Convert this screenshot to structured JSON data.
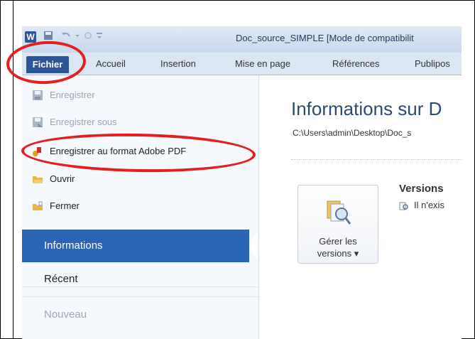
{
  "window": {
    "logo_letter": "W",
    "title": "Doc_source_SIMPLE [Mode de compatibilit"
  },
  "ribbon": {
    "tabs": [
      "Fichier",
      "Accueil",
      "Insertion",
      "Mise en page",
      "Références",
      "Publipos"
    ]
  },
  "backstage": {
    "menu": [
      {
        "label": "Enregistrer",
        "icon": "save-icon",
        "disabled": true
      },
      {
        "label": "Enregistrer sous",
        "icon": "save-as-icon",
        "disabled": true
      },
      {
        "label": "Enregistrer au format Adobe PDF",
        "icon": "adobe-pdf-icon",
        "disabled": false
      },
      {
        "label": "Ouvrir",
        "icon": "open-folder-icon",
        "disabled": false
      },
      {
        "label": "Fermer",
        "icon": "close-folder-icon",
        "disabled": false
      }
    ],
    "nav": [
      {
        "label": "Informations",
        "active": true
      },
      {
        "label": "Récent",
        "active": false
      },
      {
        "label": "Nouveau",
        "active": false,
        "disabled": true
      }
    ]
  },
  "info": {
    "title": "Informations sur D",
    "path": "C:\\Users\\admin\\Desktop\\Doc_s",
    "manage_button_line1": "Gérer les",
    "manage_button_line2": "versions ▾",
    "versions_heading": "Versions",
    "versions_text": "Il n'exis"
  },
  "colors": {
    "accent": "#2a66b5",
    "file_tab": "#2a5699",
    "annotation": "#e41f1f"
  }
}
